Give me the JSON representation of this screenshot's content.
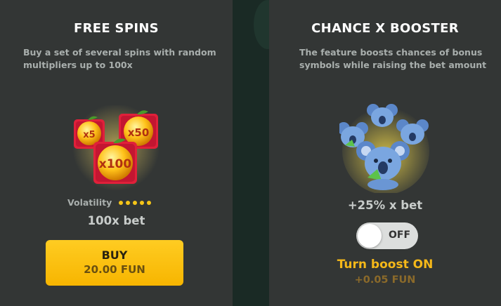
{
  "free_spins": {
    "title": "FREE SPINS",
    "description": "Buy a set of several spins with random multipliers up to 100x",
    "multipliers": [
      "x5",
      "x50",
      "x100"
    ],
    "volatility_label": "Volatility",
    "volatility_level": 5,
    "volatility_max": 5,
    "bet": "100x bet",
    "buy_label": "BUY",
    "buy_price": "20.00 FUN"
  },
  "booster": {
    "title": "CHANCE X BOOSTER",
    "description": "The feature boosts chances of bonus symbols while raising the bet amount",
    "bet_increase": "+25% x bet",
    "toggle_state": "OFF",
    "turn_label": "Turn boost ON",
    "extra_cost": "+0.05 FUN"
  },
  "colors": {
    "accent": "#f5c518",
    "panel": "#333635",
    "button": "#f7b500"
  }
}
